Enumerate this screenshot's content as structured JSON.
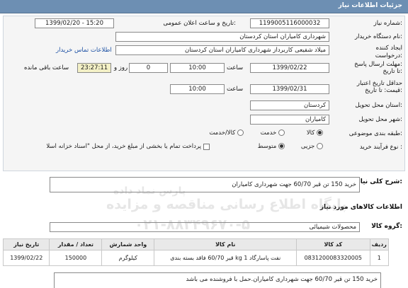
{
  "header": {
    "title": "جزئیات اطلاعات نیاز"
  },
  "fields": {
    "need_number_label": "شماره نیاز:",
    "need_number": "1199005116000032",
    "announce_label": "تاریخ و ساعت اعلان عمومی:",
    "announce_value": "1399/02/20 - 15:20",
    "buyer_org_label": "نام دستگاه خریدار:",
    "buyer_org": "شهرداری کامیاران استان کردستان",
    "creator_label": "ایجاد کننده درخواست:",
    "creator": "میلاد شفیعی کاربرداز شهرداری کامیاران استان کردستان",
    "buyer_contact_link": "اطلاعات تماس خریدار",
    "deadline_label": "مهلت ارسال پاسخ: تا تاریخ:",
    "deadline_date": "1399/02/22",
    "time_label": "ساعت",
    "deadline_time": "10:00",
    "days_value": "0",
    "days_label": "روز و",
    "remaining_time": "23:27:11",
    "remaining_label": "ساعت باقی مانده",
    "validity_label": "حداقل تاریخ اعتبار قیمت: تا تاریخ:",
    "validity_date": "1399/02/31",
    "validity_time_label": "ساعت",
    "validity_time": "10:00",
    "province_label": "استان محل تحویل:",
    "province": "کردستان",
    "city_label": "شهر محل تحویل:",
    "city": "کامیاران",
    "category_label": "طبقه بندی موضوعی:",
    "category_options": [
      "کالا",
      "خدمت",
      "کالا/خدمت"
    ],
    "purchase_type_label": "نوع فرآیند خرید :",
    "purchase_options": [
      "جزیی",
      "متوسط"
    ],
    "payment_note": "پرداخت تمام یا بخشی از مبلغ خرید، از محل \"اسناد خزانه اسلامی\" خواهد بود."
  },
  "summary": {
    "label": "شرح کلی نیاز:",
    "text": "خرید 150 تن قیر 60/70 جهت شهرداری کامیاران"
  },
  "goods": {
    "section_title": "اطلاعات کالاهای مورد نیاز",
    "group_label": "گروه کالا:",
    "group_value": "محصولات شیمیائی",
    "columns": [
      "ردیف",
      "کد کالا",
      "نام کالا",
      "واحد شمارش",
      "تعداد / مقدار",
      "تاریخ نیاز"
    ],
    "rows": [
      {
        "row": "1",
        "code": "0831200083320005",
        "name": "قیر 60/70 فاقد بسته بندی kg 1 نفت پاسارگاد",
        "unit": "کیلوگرم",
        "qty": "150000",
        "date": "1399/02/22"
      }
    ]
  },
  "description": {
    "line1": "خرید 150 تن قیر 60/70 جهت شهرداری کامیاران.حمل با فروشنده می باشد"
  },
  "watermark": {
    "line1": "پایگاه اطلاع رسانی مناقصه و مزایده",
    "line2": "۰۲۱-۸۸۳۴۹۶۷۰-۵",
    "line3": "پارس نماد داده"
  }
}
